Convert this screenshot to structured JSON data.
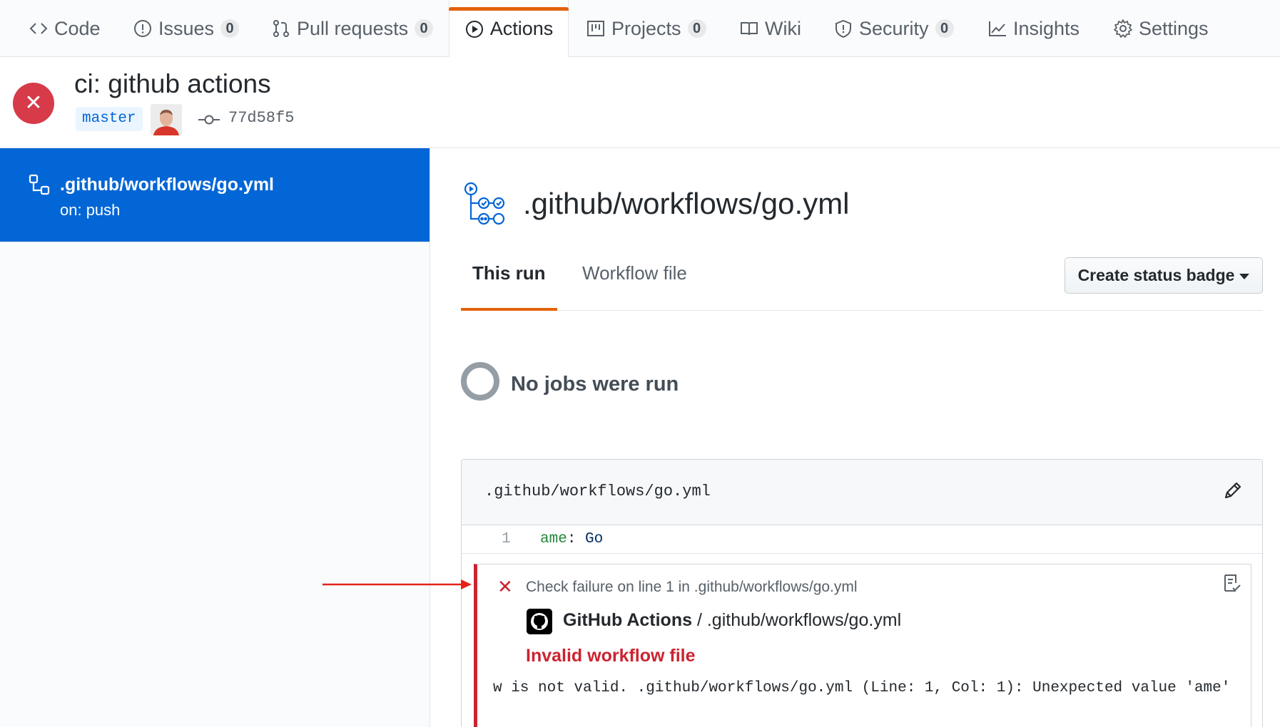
{
  "nav": {
    "tabs": [
      {
        "label": "Code",
        "icon": "code-icon"
      },
      {
        "label": "Issues",
        "count": "0",
        "icon": "issue-icon"
      },
      {
        "label": "Pull requests",
        "count": "0",
        "icon": "pull-request-icon"
      },
      {
        "label": "Actions",
        "icon": "play-icon",
        "selected": true
      },
      {
        "label": "Projects",
        "count": "0",
        "icon": "project-icon"
      },
      {
        "label": "Wiki",
        "icon": "book-icon"
      },
      {
        "label": "Security",
        "count": "0",
        "icon": "shield-icon"
      },
      {
        "label": "Insights",
        "icon": "graph-icon"
      },
      {
        "label": "Settings",
        "icon": "gear-icon"
      }
    ]
  },
  "run": {
    "status_icon": "x",
    "title": "ci: github actions",
    "branch": "master",
    "commit_sha": "77d58f5"
  },
  "sidebar": {
    "workflow_name": ".github/workflows/go.yml",
    "trigger": "on: push"
  },
  "main": {
    "title": ".github/workflows/go.yml",
    "tabs": [
      "This run",
      "Workflow file"
    ],
    "badge_button": "Create status badge",
    "no_jobs": "No jobs were run"
  },
  "file": {
    "path": ".github/workflows/go.yml",
    "line_number": "1",
    "code_key": "ame",
    "code_colon": ":",
    "code_value": "Go"
  },
  "annotation": {
    "x_glyph": "✕",
    "title": "Check failure on line 1 in .github/workflows/go.yml",
    "app_name": "GitHub Actions",
    "app_separator": " / ",
    "app_file": ".github/workflows/go.yml",
    "error_title": "Invalid workflow file",
    "message": "w is not valid. .github/workflows/go.yml (Line: 1, Col: 1): Unexpected value 'ame'"
  },
  "colors": {
    "accent": "#e36209",
    "selected_blue": "#0366d6",
    "error_red": "#cb2431",
    "status_red": "#d73a49"
  }
}
